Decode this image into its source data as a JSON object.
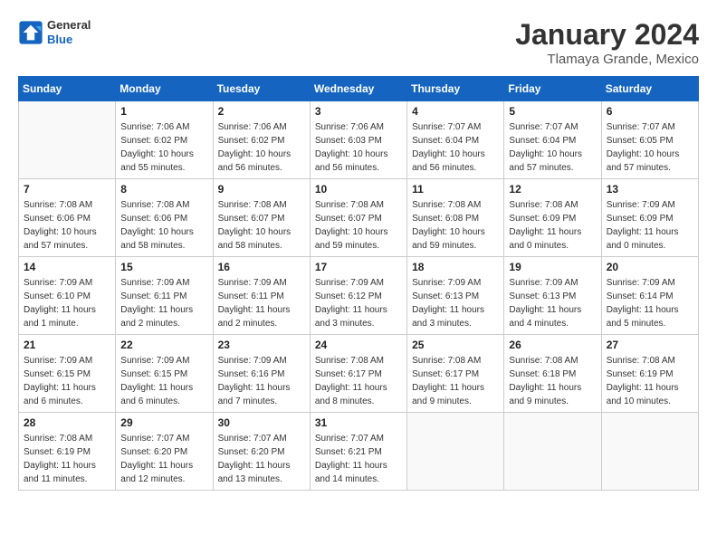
{
  "logo": {
    "line1": "General",
    "line2": "Blue"
  },
  "title": "January 2024",
  "subtitle": "Tlamaya Grande, Mexico",
  "weekdays": [
    "Sunday",
    "Monday",
    "Tuesday",
    "Wednesday",
    "Thursday",
    "Friday",
    "Saturday"
  ],
  "weeks": [
    [
      {
        "day": null
      },
      {
        "day": 1,
        "sunrise": "7:06 AM",
        "sunset": "6:02 PM",
        "daylight": "10 hours and 55 minutes."
      },
      {
        "day": 2,
        "sunrise": "7:06 AM",
        "sunset": "6:02 PM",
        "daylight": "10 hours and 56 minutes."
      },
      {
        "day": 3,
        "sunrise": "7:06 AM",
        "sunset": "6:03 PM",
        "daylight": "10 hours and 56 minutes."
      },
      {
        "day": 4,
        "sunrise": "7:07 AM",
        "sunset": "6:04 PM",
        "daylight": "10 hours and 56 minutes."
      },
      {
        "day": 5,
        "sunrise": "7:07 AM",
        "sunset": "6:04 PM",
        "daylight": "10 hours and 57 minutes."
      },
      {
        "day": 6,
        "sunrise": "7:07 AM",
        "sunset": "6:05 PM",
        "daylight": "10 hours and 57 minutes."
      }
    ],
    [
      {
        "day": 7,
        "sunrise": "7:08 AM",
        "sunset": "6:06 PM",
        "daylight": "10 hours and 57 minutes."
      },
      {
        "day": 8,
        "sunrise": "7:08 AM",
        "sunset": "6:06 PM",
        "daylight": "10 hours and 58 minutes."
      },
      {
        "day": 9,
        "sunrise": "7:08 AM",
        "sunset": "6:07 PM",
        "daylight": "10 hours and 58 minutes."
      },
      {
        "day": 10,
        "sunrise": "7:08 AM",
        "sunset": "6:07 PM",
        "daylight": "10 hours and 59 minutes."
      },
      {
        "day": 11,
        "sunrise": "7:08 AM",
        "sunset": "6:08 PM",
        "daylight": "10 hours and 59 minutes."
      },
      {
        "day": 12,
        "sunrise": "7:08 AM",
        "sunset": "6:09 PM",
        "daylight": "11 hours and 0 minutes."
      },
      {
        "day": 13,
        "sunrise": "7:09 AM",
        "sunset": "6:09 PM",
        "daylight": "11 hours and 0 minutes."
      }
    ],
    [
      {
        "day": 14,
        "sunrise": "7:09 AM",
        "sunset": "6:10 PM",
        "daylight": "11 hours and 1 minute."
      },
      {
        "day": 15,
        "sunrise": "7:09 AM",
        "sunset": "6:11 PM",
        "daylight": "11 hours and 2 minutes."
      },
      {
        "day": 16,
        "sunrise": "7:09 AM",
        "sunset": "6:11 PM",
        "daylight": "11 hours and 2 minutes."
      },
      {
        "day": 17,
        "sunrise": "7:09 AM",
        "sunset": "6:12 PM",
        "daylight": "11 hours and 3 minutes."
      },
      {
        "day": 18,
        "sunrise": "7:09 AM",
        "sunset": "6:13 PM",
        "daylight": "11 hours and 3 minutes."
      },
      {
        "day": 19,
        "sunrise": "7:09 AM",
        "sunset": "6:13 PM",
        "daylight": "11 hours and 4 minutes."
      },
      {
        "day": 20,
        "sunrise": "7:09 AM",
        "sunset": "6:14 PM",
        "daylight": "11 hours and 5 minutes."
      }
    ],
    [
      {
        "day": 21,
        "sunrise": "7:09 AM",
        "sunset": "6:15 PM",
        "daylight": "11 hours and 6 minutes."
      },
      {
        "day": 22,
        "sunrise": "7:09 AM",
        "sunset": "6:15 PM",
        "daylight": "11 hours and 6 minutes."
      },
      {
        "day": 23,
        "sunrise": "7:09 AM",
        "sunset": "6:16 PM",
        "daylight": "11 hours and 7 minutes."
      },
      {
        "day": 24,
        "sunrise": "7:08 AM",
        "sunset": "6:17 PM",
        "daylight": "11 hours and 8 minutes."
      },
      {
        "day": 25,
        "sunrise": "7:08 AM",
        "sunset": "6:17 PM",
        "daylight": "11 hours and 9 minutes."
      },
      {
        "day": 26,
        "sunrise": "7:08 AM",
        "sunset": "6:18 PM",
        "daylight": "11 hours and 9 minutes."
      },
      {
        "day": 27,
        "sunrise": "7:08 AM",
        "sunset": "6:19 PM",
        "daylight": "11 hours and 10 minutes."
      }
    ],
    [
      {
        "day": 28,
        "sunrise": "7:08 AM",
        "sunset": "6:19 PM",
        "daylight": "11 hours and 11 minutes."
      },
      {
        "day": 29,
        "sunrise": "7:07 AM",
        "sunset": "6:20 PM",
        "daylight": "11 hours and 12 minutes."
      },
      {
        "day": 30,
        "sunrise": "7:07 AM",
        "sunset": "6:20 PM",
        "daylight": "11 hours and 13 minutes."
      },
      {
        "day": 31,
        "sunrise": "7:07 AM",
        "sunset": "6:21 PM",
        "daylight": "11 hours and 14 minutes."
      },
      {
        "day": null
      },
      {
        "day": null
      },
      {
        "day": null
      }
    ]
  ]
}
